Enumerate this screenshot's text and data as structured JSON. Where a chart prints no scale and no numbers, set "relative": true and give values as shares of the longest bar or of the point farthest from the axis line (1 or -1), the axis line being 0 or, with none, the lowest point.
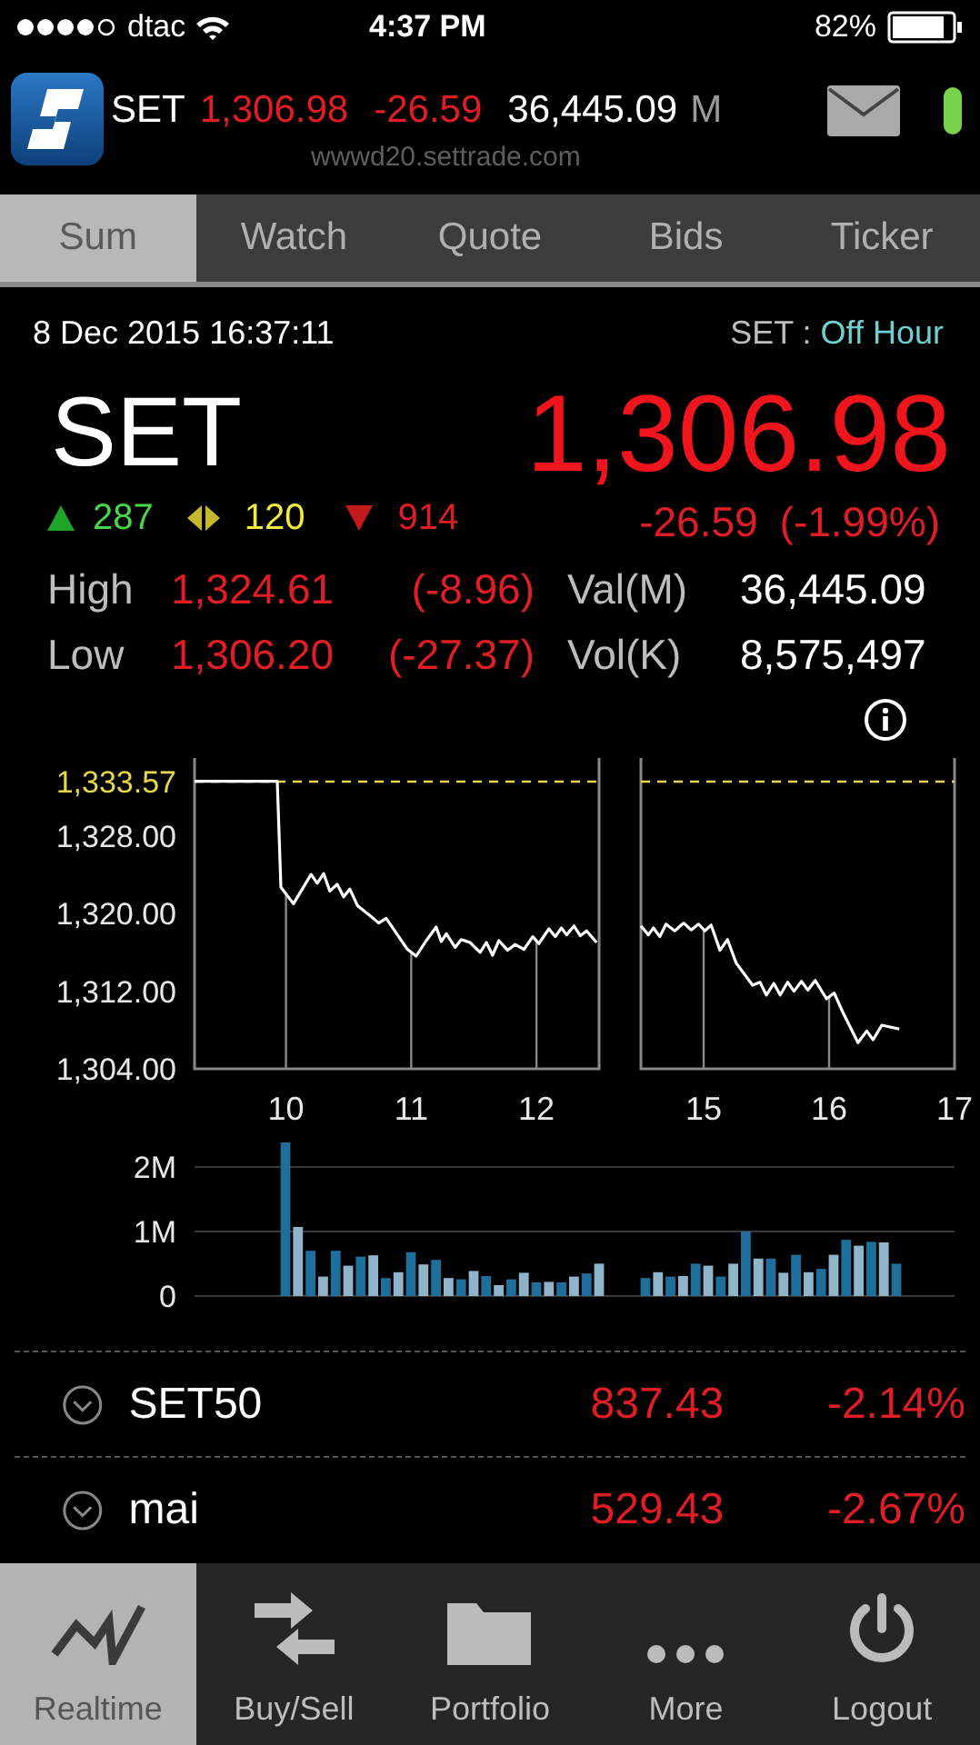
{
  "status_bar": {
    "carrier": "dtac",
    "time": "4:37 PM",
    "battery": "82%"
  },
  "header": {
    "symbol": "SET",
    "last": "1,306.98",
    "change": "-26.59",
    "value": "36,445.09",
    "unit": "M",
    "server": "wwwd20.settrade.com"
  },
  "tabs": [
    {
      "label": "Sum",
      "selected": true
    },
    {
      "label": "Watch",
      "selected": false
    },
    {
      "label": "Quote",
      "selected": false
    },
    {
      "label": "Bids",
      "selected": false
    },
    {
      "label": "Ticker",
      "selected": false
    }
  ],
  "summary": {
    "datetime": "8 Dec 2015 16:37:11",
    "market_label": "SET :",
    "market_status": "Off Hour",
    "index": "SET",
    "last": "1,306.98",
    "change": "-26.59",
    "percent": "(-1.99%)",
    "advances": "287",
    "unchanged": "120",
    "declines": "914",
    "price_stats": [
      {
        "label": "High",
        "value": "1,324.61",
        "change": "(-8.96)"
      },
      {
        "label": "Low",
        "value": "1,306.20",
        "change": "(-27.37)"
      }
    ],
    "trade_stats": [
      {
        "label": "Val(M)",
        "value": "36,445.09"
      },
      {
        "label": "Vol(K)",
        "value": "8,575,497"
      }
    ]
  },
  "price_chart": {
    "morning": {
      "chart_data": {
        "type": "line",
        "xlim": [
          9.27,
          12.5
        ],
        "ylim": [
          1304,
          1336
        ],
        "xticks": [
          10,
          11,
          12
        ],
        "yticks": [
          {
            "value": 1333.57,
            "label": "1,333.57"
          },
          {
            "value": 1328,
            "label": "1,328.00"
          },
          {
            "value": 1320,
            "label": "1,320.00"
          },
          {
            "value": 1312,
            "label": "1,312.00"
          },
          {
            "value": 1304,
            "label": "1,304.00"
          }
        ],
        "ref_lines": [
          {
            "axis": "y",
            "value": 1333.57
          },
          {
            "axis": "x",
            "value": 10
          },
          {
            "axis": "x",
            "value": 11
          },
          {
            "axis": "x",
            "value": 12
          }
        ],
        "x": [
          9.27,
          9.93,
          9.96,
          10.06,
          10.2,
          10.25,
          10.3,
          10.35,
          10.41,
          10.46,
          10.51,
          10.57,
          10.67,
          10.74,
          10.8,
          10.97,
          11.04,
          11.12,
          11.2,
          11.24,
          11.28,
          11.35,
          11.4,
          11.47,
          11.55,
          11.6,
          11.65,
          11.7,
          11.77,
          11.83,
          11.9,
          11.97,
          12.02,
          12.1,
          12.15,
          12.2,
          12.24,
          12.3,
          12.35,
          12.4,
          12.48
        ],
        "series": [
          {
            "color": "#ffffff",
            "values": [
              1333.6,
              1333.6,
              1322.7,
              1321.0,
              1324.0,
              1323.1,
              1324.1,
              1322.3,
              1323.0,
              1321.7,
              1322.5,
              1320.8,
              1319.8,
              1319.0,
              1319.5,
              1316.3,
              1315.6,
              1317.2,
              1318.6,
              1317.1,
              1317.9,
              1316.5,
              1317.3,
              1317.0,
              1316.0,
              1317.0,
              1315.7,
              1317.2,
              1316.2,
              1316.8,
              1316.3,
              1317.6,
              1316.9,
              1318.4,
              1317.6,
              1318.5,
              1317.8,
              1318.7,
              1317.7,
              1318.2,
              1317.0
            ]
          }
        ]
      }
    },
    "afternoon": {
      "chart_data": {
        "type": "line",
        "xlim": [
          14.5,
          17
        ],
        "ylim": [
          1304,
          1336
        ],
        "xticks": [
          15,
          16,
          17
        ],
        "ref_lines": [
          {
            "axis": "y",
            "value": 1333.57
          },
          {
            "axis": "x",
            "value": 15
          },
          {
            "axis": "x",
            "value": 16
          }
        ],
        "x": [
          14.5,
          14.56,
          14.6,
          14.65,
          14.7,
          14.77,
          14.84,
          14.9,
          14.96,
          15.01,
          15.06,
          15.13,
          15.19,
          15.26,
          15.39,
          15.45,
          15.5,
          15.56,
          15.61,
          15.67,
          15.72,
          15.78,
          15.83,
          15.89,
          15.98,
          16.04,
          16.11,
          16.23,
          16.3,
          16.35,
          16.42,
          16.56
        ],
        "series": [
          {
            "color": "#ffffff",
            "values": [
              1318.7,
              1317.8,
              1318.5,
              1317.6,
              1318.9,
              1318.2,
              1319.0,
              1318.3,
              1318.9,
              1318.2,
              1318.8,
              1316.2,
              1317.3,
              1314.9,
              1312.6,
              1312.9,
              1311.6,
              1312.8,
              1311.6,
              1312.9,
              1312.0,
              1313.0,
              1312.1,
              1313.1,
              1311.2,
              1311.8,
              1309.8,
              1306.7,
              1307.9,
              1307.0,
              1308.5,
              1308.1
            ]
          }
        ]
      }
    }
  },
  "volume_chart": {
    "morning": {
      "chart_data": {
        "type": "bar",
        "stacked": true,
        "ylim": [
          0,
          2.45
        ],
        "yticks": [
          {
            "value": 0,
            "label": "0"
          },
          {
            "value": 1,
            "label": "1M"
          },
          {
            "value": 2,
            "label": "2M"
          }
        ],
        "categories": [
          null,
          null,
          null,
          null,
          null,
          null,
          null,
          null,
          null,
          null,
          null,
          null,
          null,
          null,
          null,
          null,
          null,
          null,
          null,
          null,
          null,
          null,
          null,
          null,
          null,
          null
        ],
        "series": [
          {
            "color": "#1f6f9c",
            "values": [
              2.38,
              0,
              0.7,
              0,
              0.7,
              0,
              0.61,
              0,
              0.28,
              0,
              0.68,
              0,
              0.56,
              0,
              0.26,
              0,
              0.31,
              0,
              0.26,
              0,
              0.21,
              0,
              0.21,
              0,
              0.35,
              0
            ]
          },
          {
            "color": "#8fb3c9",
            "values": [
              0,
              1.07,
              0,
              0.3,
              0,
              0.47,
              0,
              0.63,
              0,
              0.37,
              0,
              0.49,
              0,
              0.28,
              0,
              0.39,
              0,
              0.17,
              0,
              0.36,
              0,
              0.22,
              0,
              0.3,
              0,
              0.5
            ]
          }
        ]
      }
    },
    "afternoon": {
      "chart_data": {
        "type": "bar",
        "stacked": true,
        "relative": true,
        "categories": [
          null,
          null,
          null,
          null,
          null,
          null,
          null,
          null,
          null,
          null,
          null,
          null,
          null,
          null,
          null,
          null,
          null,
          null,
          null,
          null,
          null
        ],
        "series": [
          {
            "color": "#1f6f9c",
            "values": [
              0.28,
              0,
              0.3,
              0,
              0.5,
              0,
              0.3,
              0,
              1.0,
              0,
              0.58,
              0,
              0.64,
              0,
              0.42,
              0,
              0.87,
              0,
              0.84,
              0,
              0.5
            ]
          },
          {
            "color": "#8fb3c9",
            "values": [
              0,
              0.37,
              0,
              0.31,
              0,
              0.47,
              0,
              0.5,
              0,
              0.58,
              0,
              0.36,
              0,
              0.37,
              0,
              0.64,
              0,
              0.78,
              0,
              0.83,
              0
            ]
          }
        ]
      }
    }
  },
  "indices": [
    {
      "name": "SET50",
      "value": "837.43",
      "change": "-2.14%"
    },
    {
      "name": "mai",
      "value": "529.43",
      "change": "-2.67%"
    }
  ],
  "nav": [
    {
      "label": "Realtime",
      "selected": true
    },
    {
      "label": "Buy/Sell",
      "selected": false
    },
    {
      "label": "Portfolio",
      "selected": false
    },
    {
      "label": "More",
      "selected": false
    },
    {
      "label": "Logout",
      "selected": false
    }
  ]
}
